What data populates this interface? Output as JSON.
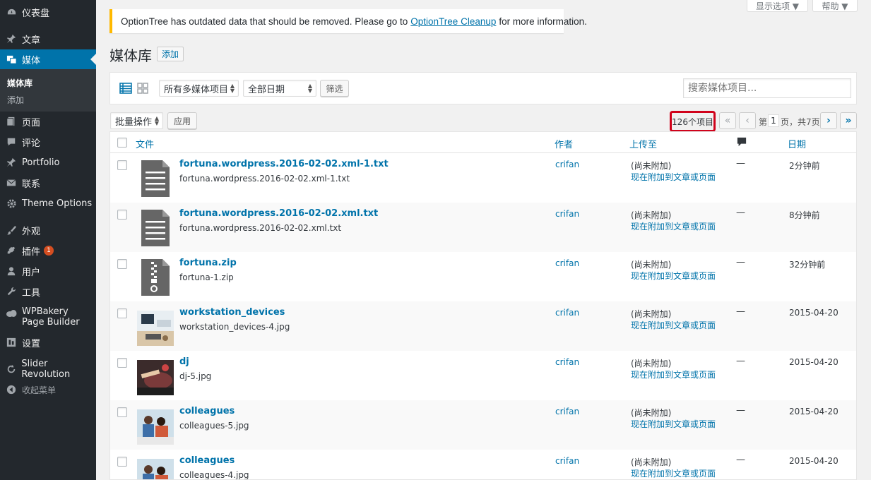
{
  "sidebar": {
    "items": [
      {
        "label": "仪表盘",
        "icon": "dashboard-icon"
      },
      {
        "label": "文章",
        "icon": "pin-icon"
      },
      {
        "label": "媒体",
        "icon": "media-icon"
      },
      {
        "label": "页面",
        "icon": "page-icon"
      },
      {
        "label": "评论",
        "icon": "comment-icon"
      },
      {
        "label": "Portfolio",
        "icon": "pin-icon"
      },
      {
        "label": "联系",
        "icon": "mail-icon"
      },
      {
        "label": "Theme Options",
        "icon": "gear-icon"
      },
      {
        "label": "外观",
        "icon": "brush-icon"
      },
      {
        "label": "插件",
        "icon": "plugin-icon",
        "badge": "1"
      },
      {
        "label": "用户",
        "icon": "user-icon"
      },
      {
        "label": "工具",
        "icon": "wrench-icon"
      },
      {
        "label": "WPBakery Page Builder",
        "icon": "cloud-icon"
      },
      {
        "label": "设置",
        "icon": "settings-icon"
      },
      {
        "label": "Slider Revolution",
        "icon": "refresh-icon"
      },
      {
        "label": "收起菜单",
        "icon": "collapse-icon"
      }
    ],
    "submenu": [
      {
        "label": "媒体库"
      },
      {
        "label": "添加"
      }
    ]
  },
  "screen_meta": {
    "options_label": "显示选项 ▼",
    "help_label": "帮助 ▼"
  },
  "notice": {
    "text_before": "OptionTree has outdated data that should be removed. Please go to",
    "link": "OptionTree Cleanup",
    "text_after": "for more information."
  },
  "page": {
    "title": "媒体库",
    "add_new": "添加"
  },
  "filters": {
    "type_select": "所有多媒体项目",
    "date_select": "全部日期",
    "filter_button": "筛选",
    "search_placeholder": "搜索媒体项目..."
  },
  "bulk": {
    "select": "批量操作",
    "apply": "应用"
  },
  "pagination": {
    "count": "126个项目",
    "first": "«",
    "prev": "‹",
    "page_prefix": "第",
    "current": "1",
    "page_suffix": "页，共7页",
    "next": "›",
    "last": "»"
  },
  "table": {
    "headers": {
      "file": "文件",
      "author": "作者",
      "uploaded_to": "上传至",
      "date": "日期"
    },
    "rows": [
      {
        "title": "fortuna.wordpress.2016-02-02.xml-1.txt",
        "filename": "fortuna.wordpress.2016-02-02.xml-1.txt",
        "author": "crifan",
        "status": "(尚未附加)",
        "attach": "现在附加到文章或页面",
        "comments": "—",
        "date": "2分钟前",
        "thumb": "document"
      },
      {
        "title": "fortuna.wordpress.2016-02-02.xml.txt",
        "filename": "fortuna.wordpress.2016-02-02.xml.txt",
        "author": "crifan",
        "status": "(尚未附加)",
        "attach": "现在附加到文章或页面",
        "comments": "—",
        "date": "8分钟前",
        "thumb": "document"
      },
      {
        "title": "fortuna.zip",
        "filename": "fortuna-1.zip",
        "author": "crifan",
        "status": "(尚未附加)",
        "attach": "现在附加到文章或页面",
        "comments": "—",
        "date": "32分钟前",
        "thumb": "archive"
      },
      {
        "title": "workstation_devices",
        "filename": "workstation_devices-4.jpg",
        "author": "crifan",
        "status": "(尚未附加)",
        "attach": "现在附加到文章或页面",
        "comments": "—",
        "date": "2015-04-20",
        "thumb": "photo-desk"
      },
      {
        "title": "dj",
        "filename": "dj-5.jpg",
        "author": "crifan",
        "status": "(尚未附加)",
        "attach": "现在附加到文章或页面",
        "comments": "—",
        "date": "2015-04-20",
        "thumb": "photo-dj"
      },
      {
        "title": "colleagues",
        "filename": "colleagues-5.jpg",
        "author": "crifan",
        "status": "(尚未附加)",
        "attach": "现在附加到文章或页面",
        "comments": "—",
        "date": "2015-04-20",
        "thumb": "photo-people"
      },
      {
        "title": "colleagues",
        "filename": "colleagues-4.jpg",
        "author": "crifan",
        "status": "(尚未附加)",
        "attach": "现在附加到文章或页面",
        "comments": "—",
        "date": "2015-04-20",
        "thumb": "photo-people"
      }
    ]
  },
  "colors": {
    "sidebar_bg": "#23282d",
    "accent": "#0073aa",
    "notice_border": "#ffb900",
    "highlight": "#d0021b"
  }
}
